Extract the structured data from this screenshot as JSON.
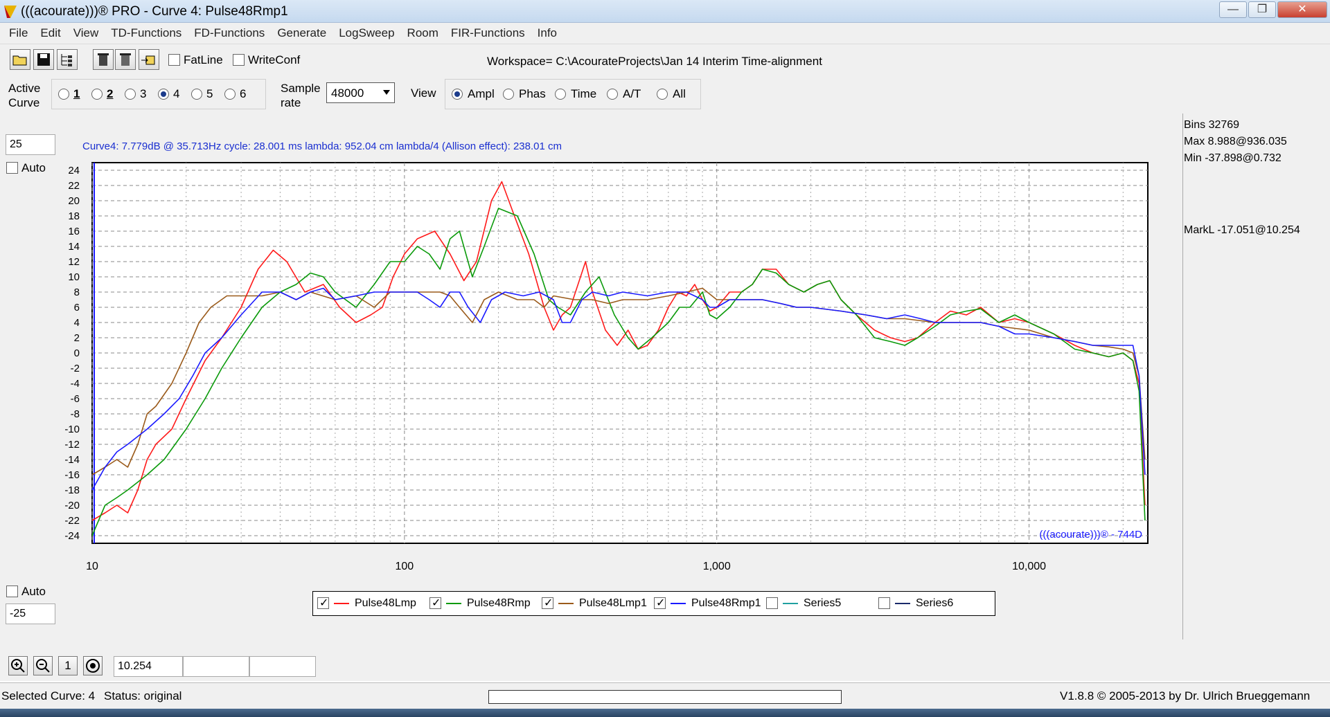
{
  "window": {
    "title": "(((acourate)))® PRO - Curve 4: Pulse48Rmp1",
    "minimize": "—",
    "maximize": "❐",
    "close": "✕"
  },
  "menu": [
    "File",
    "Edit",
    "View",
    "TD-Functions",
    "FD-Functions",
    "Generate",
    "LogSweep",
    "Room",
    "FIR-Functions",
    "Info"
  ],
  "toolbar": {
    "fatline_label": "FatLine",
    "fatline_checked": false,
    "writeconf_label": "WriteConf",
    "writeconf_checked": false,
    "workspace": "Workspace= C:\\AcourateProjects\\Jan 14 Interim Time-alignment"
  },
  "options": {
    "active_curve_label": "Active Curve",
    "active_curve_line1": "Active",
    "active_curve_line2": "Curve",
    "curves": [
      "1",
      "2",
      "3",
      "4",
      "5",
      "6"
    ],
    "selected_curve": "4",
    "sample_rate_line1": "Sample",
    "sample_rate_line2": "rate",
    "sample_rate_value": "48000",
    "view_label": "View",
    "view_modes": [
      "Ampl",
      "Phas",
      "Time",
      "A/T",
      "All"
    ],
    "selected_view": "Ampl"
  },
  "axis_controls": {
    "ymax_value": "25",
    "ymin_value": "-25",
    "auto_top_label": "Auto",
    "auto_bottom_label": "Auto"
  },
  "info_line": "Curve4:  7.779dB @ 35.713Hz    cycle: 28.001 ms    lambda: 952.04 cm    lambda/4 (Allison effect): 238.01 cm",
  "side_panel": {
    "bins": "Bins 32769",
    "max": "Max 8.988@936.035",
    "min": "Min -37.898@0.732",
    "markl": "MarkL -17.051@10.254"
  },
  "watermark": "(((acourate)))® - 744D",
  "legend": [
    {
      "name": "Pulse48Lmp",
      "checked": true,
      "color": "#ff1a1a"
    },
    {
      "name": "Pulse48Rmp",
      "checked": true,
      "color": "#0a9a0a"
    },
    {
      "name": "Pulse48Lmp1",
      "checked": true,
      "color": "#9a5a1a"
    },
    {
      "name": "Pulse48Rmp1",
      "checked": true,
      "color": "#1a1aff"
    },
    {
      "name": "Series5",
      "checked": false,
      "color": "#20a0a0"
    },
    {
      "name": "Series6",
      "checked": false,
      "color": "#1a2a6a"
    }
  ],
  "bottom": {
    "zoom_in": "zoom-in",
    "zoom_out": "zoom-out",
    "one_label": "1",
    "mark_value": "10.254"
  },
  "status": {
    "selected": "Selected Curve: 4",
    "status": "Status: original",
    "version": "V1.8.8 © 2005-2013 by Dr. Ulrich Brueggemann"
  },
  "chart_data": {
    "type": "line",
    "xscale": "log",
    "xlim": [
      10,
      24000
    ],
    "ylim": [
      -25,
      25
    ],
    "x_tick_labels": [
      "10",
      "100",
      "1,000",
      "10,000"
    ],
    "y_tick_labels": [
      "24",
      "22",
      "20",
      "18",
      "16",
      "14",
      "12",
      "10",
      "8",
      "6",
      "4",
      "2",
      "0",
      "-2",
      "-4",
      "-6",
      "-8",
      "-10",
      "-12",
      "-14",
      "-16",
      "-18",
      "-20",
      "-22",
      "-24"
    ],
    "grid": true,
    "legend_position": "bottom",
    "series": [
      {
        "name": "Pulse48Lmp",
        "color": "#ff1a1a",
        "points": [
          [
            10,
            -22
          ],
          [
            11,
            -21
          ],
          [
            12,
            -20
          ],
          [
            13,
            -21
          ],
          [
            14,
            -18
          ],
          [
            15,
            -14
          ],
          [
            16,
            -12
          ],
          [
            18,
            -10
          ],
          [
            20,
            -6
          ],
          [
            23,
            -1
          ],
          [
            26,
            2
          ],
          [
            30,
            6
          ],
          [
            34,
            11
          ],
          [
            38,
            13.5
          ],
          [
            42,
            12
          ],
          [
            48,
            8
          ],
          [
            55,
            9
          ],
          [
            62,
            6
          ],
          [
            70,
            4
          ],
          [
            78,
            5
          ],
          [
            85,
            6
          ],
          [
            92,
            10
          ],
          [
            100,
            13
          ],
          [
            110,
            15
          ],
          [
            125,
            16
          ],
          [
            140,
            13
          ],
          [
            155,
            9.5
          ],
          [
            170,
            12
          ],
          [
            190,
            20
          ],
          [
            205,
            22.5
          ],
          [
            225,
            18
          ],
          [
            250,
            13
          ],
          [
            280,
            6
          ],
          [
            300,
            3
          ],
          [
            320,
            5
          ],
          [
            340,
            6
          ],
          [
            380,
            12
          ],
          [
            400,
            8
          ],
          [
            440,
            3
          ],
          [
            480,
            1
          ],
          [
            520,
            3
          ],
          [
            560,
            0.5
          ],
          [
            600,
            1
          ],
          [
            650,
            3
          ],
          [
            700,
            6
          ],
          [
            750,
            8
          ],
          [
            800,
            7.5
          ],
          [
            850,
            9
          ],
          [
            900,
            7
          ],
          [
            950,
            5.5
          ],
          [
            1000,
            6
          ],
          [
            1100,
            8
          ],
          [
            1200,
            8
          ],
          [
            1300,
            9
          ],
          [
            1400,
            11
          ],
          [
            1550,
            11
          ],
          [
            1700,
            9
          ],
          [
            1900,
            8
          ],
          [
            2100,
            9
          ],
          [
            2300,
            9.5
          ],
          [
            2500,
            7
          ],
          [
            2800,
            5
          ],
          [
            3200,
            3
          ],
          [
            3600,
            2
          ],
          [
            4000,
            1.5
          ],
          [
            4400,
            2
          ],
          [
            5000,
            4
          ],
          [
            5600,
            5.5
          ],
          [
            6300,
            5
          ],
          [
            7000,
            6
          ],
          [
            8000,
            4
          ],
          [
            9000,
            4.5
          ],
          [
            10000,
            4
          ],
          [
            12000,
            2.5
          ],
          [
            14000,
            1
          ],
          [
            16000,
            0
          ],
          [
            18000,
            -0.5
          ],
          [
            20000,
            0
          ],
          [
            21500,
            -1
          ],
          [
            22500,
            -4
          ],
          [
            23500,
            -20
          ]
        ]
      },
      {
        "name": "Pulse48Rmp",
        "color": "#0a9a0a",
        "points": [
          [
            10,
            -24
          ],
          [
            11,
            -20
          ],
          [
            12,
            -19
          ],
          [
            13,
            -18
          ],
          [
            15,
            -16
          ],
          [
            17,
            -14
          ],
          [
            20,
            -10
          ],
          [
            23,
            -6
          ],
          [
            26,
            -2
          ],
          [
            30,
            2
          ],
          [
            35,
            6
          ],
          [
            40,
            8
          ],
          [
            45,
            9
          ],
          [
            50,
            10.5
          ],
          [
            55,
            10
          ],
          [
            60,
            8
          ],
          [
            70,
            6
          ],
          [
            80,
            9
          ],
          [
            90,
            12
          ],
          [
            100,
            12
          ],
          [
            110,
            14
          ],
          [
            120,
            13
          ],
          [
            130,
            11
          ],
          [
            140,
            15
          ],
          [
            150,
            16
          ],
          [
            165,
            10
          ],
          [
            180,
            14
          ],
          [
            200,
            19
          ],
          [
            230,
            18
          ],
          [
            260,
            13
          ],
          [
            290,
            7
          ],
          [
            310,
            6
          ],
          [
            340,
            5
          ],
          [
            380,
            8
          ],
          [
            420,
            10
          ],
          [
            470,
            5
          ],
          [
            520,
            2
          ],
          [
            560,
            0.5
          ],
          [
            620,
            2
          ],
          [
            700,
            4
          ],
          [
            760,
            6
          ],
          [
            820,
            6
          ],
          [
            900,
            8
          ],
          [
            950,
            5
          ],
          [
            1000,
            4.5
          ],
          [
            1100,
            6
          ],
          [
            1200,
            8
          ],
          [
            1300,
            9
          ],
          [
            1400,
            11
          ],
          [
            1550,
            10.5
          ],
          [
            1700,
            9
          ],
          [
            1900,
            8
          ],
          [
            2100,
            9
          ],
          [
            2300,
            9.5
          ],
          [
            2500,
            7
          ],
          [
            2800,
            5
          ],
          [
            3200,
            2
          ],
          [
            3600,
            1.5
          ],
          [
            4000,
            1
          ],
          [
            4400,
            2
          ],
          [
            5000,
            3.5
          ],
          [
            5600,
            5
          ],
          [
            6300,
            5.5
          ],
          [
            7000,
            5.8
          ],
          [
            8000,
            4
          ],
          [
            9000,
            5
          ],
          [
            10000,
            4
          ],
          [
            12000,
            2.5
          ],
          [
            14000,
            0.5
          ],
          [
            16000,
            0
          ],
          [
            18000,
            -0.5
          ],
          [
            20000,
            0
          ],
          [
            21500,
            -1
          ],
          [
            22500,
            -5
          ],
          [
            23500,
            -22
          ]
        ]
      },
      {
        "name": "Pulse48Lmp1",
        "color": "#9a5a1a",
        "points": [
          [
            10,
            -16
          ],
          [
            11,
            -15
          ],
          [
            12,
            -14
          ],
          [
            13,
            -15
          ],
          [
            14,
            -12
          ],
          [
            15,
            -8
          ],
          [
            16,
            -7
          ],
          [
            18,
            -4
          ],
          [
            20,
            0
          ],
          [
            22,
            4
          ],
          [
            24,
            6
          ],
          [
            27,
            7.5
          ],
          [
            30,
            7.5
          ],
          [
            35,
            7.5
          ],
          [
            40,
            8
          ],
          [
            45,
            7
          ],
          [
            50,
            8
          ],
          [
            60,
            7
          ],
          [
            70,
            7.5
          ],
          [
            80,
            6
          ],
          [
            90,
            8
          ],
          [
            100,
            8
          ],
          [
            120,
            8
          ],
          [
            130,
            8
          ],
          [
            140,
            7.5
          ],
          [
            150,
            6
          ],
          [
            165,
            4
          ],
          [
            180,
            7
          ],
          [
            200,
            8
          ],
          [
            230,
            7
          ],
          [
            260,
            7
          ],
          [
            280,
            6
          ],
          [
            300,
            7.5
          ],
          [
            350,
            7
          ],
          [
            400,
            7
          ],
          [
            450,
            6.5
          ],
          [
            500,
            7
          ],
          [
            600,
            7
          ],
          [
            700,
            7.5
          ],
          [
            800,
            8
          ],
          [
            900,
            8.5
          ],
          [
            1000,
            7
          ],
          [
            1100,
            7
          ],
          [
            1200,
            7
          ],
          [
            1400,
            7
          ],
          [
            1600,
            6.5
          ],
          [
            1800,
            6
          ],
          [
            2000,
            6
          ],
          [
            2500,
            5.5
          ],
          [
            3000,
            5
          ],
          [
            3500,
            4.5
          ],
          [
            4000,
            4.5
          ],
          [
            5000,
            4
          ],
          [
            6000,
            4
          ],
          [
            7000,
            4
          ],
          [
            8000,
            3.5
          ],
          [
            10000,
            3
          ],
          [
            12000,
            2
          ],
          [
            14000,
            1.5
          ],
          [
            16000,
            1
          ],
          [
            18000,
            0.8
          ],
          [
            20000,
            0.5
          ],
          [
            21500,
            0
          ],
          [
            22500,
            -3
          ],
          [
            23500,
            -14
          ]
        ]
      },
      {
        "name": "Pulse48Rmp1",
        "color": "#1a1aff",
        "points": [
          [
            10,
            -18
          ],
          [
            11,
            -15
          ],
          [
            12,
            -13
          ],
          [
            13,
            -12
          ],
          [
            15,
            -10
          ],
          [
            17,
            -8
          ],
          [
            19,
            -6
          ],
          [
            21,
            -3
          ],
          [
            23,
            0
          ],
          [
            26,
            2
          ],
          [
            30,
            5
          ],
          [
            35,
            8
          ],
          [
            40,
            8
          ],
          [
            45,
            7
          ],
          [
            50,
            8
          ],
          [
            55,
            8.5
          ],
          [
            60,
            7
          ],
          [
            70,
            7.5
          ],
          [
            80,
            8
          ],
          [
            90,
            8
          ],
          [
            100,
            8
          ],
          [
            110,
            8
          ],
          [
            120,
            7
          ],
          [
            130,
            6
          ],
          [
            140,
            8
          ],
          [
            150,
            8
          ],
          [
            160,
            6
          ],
          [
            175,
            4
          ],
          [
            190,
            7
          ],
          [
            210,
            8
          ],
          [
            240,
            7.5
          ],
          [
            270,
            8
          ],
          [
            300,
            7
          ],
          [
            320,
            4
          ],
          [
            340,
            4
          ],
          [
            370,
            7
          ],
          [
            400,
            8
          ],
          [
            450,
            7.5
          ],
          [
            500,
            8
          ],
          [
            600,
            7.5
          ],
          [
            700,
            8
          ],
          [
            800,
            8
          ],
          [
            900,
            7
          ],
          [
            950,
            6
          ],
          [
            1000,
            6
          ],
          [
            1100,
            7
          ],
          [
            1200,
            7
          ],
          [
            1400,
            7
          ],
          [
            1600,
            6.5
          ],
          [
            1800,
            6
          ],
          [
            2000,
            6
          ],
          [
            2500,
            5.5
          ],
          [
            3000,
            5
          ],
          [
            3500,
            4.5
          ],
          [
            4000,
            5
          ],
          [
            4500,
            4.5
          ],
          [
            5000,
            4
          ],
          [
            6000,
            4
          ],
          [
            7000,
            4
          ],
          [
            8000,
            3.5
          ],
          [
            9000,
            2.5
          ],
          [
            10000,
            2.5
          ],
          [
            12000,
            2
          ],
          [
            14000,
            1.5
          ],
          [
            16000,
            1
          ],
          [
            18000,
            1
          ],
          [
            20000,
            1
          ],
          [
            21500,
            1
          ],
          [
            22500,
            -3
          ],
          [
            23500,
            -16
          ]
        ]
      }
    ]
  }
}
